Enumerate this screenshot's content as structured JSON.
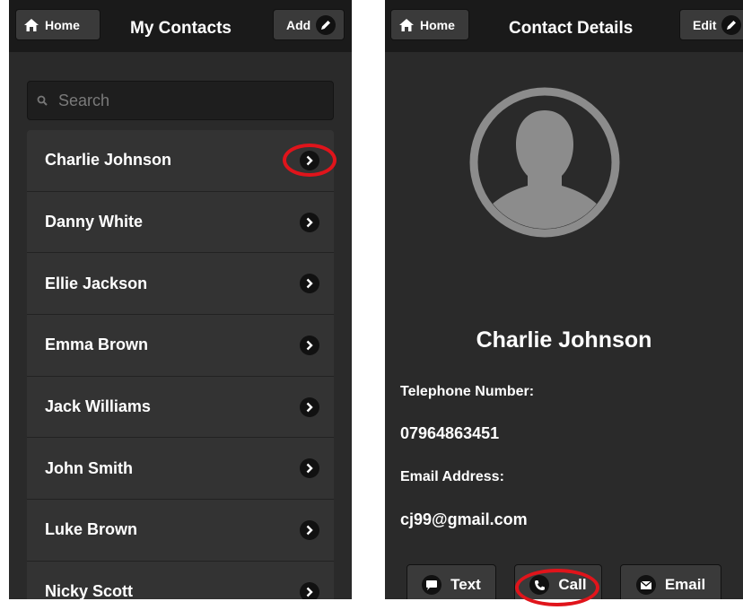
{
  "contacts_screen": {
    "home_label": "Home",
    "title": "My Contacts",
    "add_label": "Add",
    "search_placeholder": "Search",
    "contacts": [
      {
        "name": "Charlie Johnson"
      },
      {
        "name": "Danny White"
      },
      {
        "name": "Ellie Jackson"
      },
      {
        "name": "Emma Brown"
      },
      {
        "name": "Jack Williams"
      },
      {
        "name": "John Smith"
      },
      {
        "name": "Luke Brown"
      },
      {
        "name": "Nicky Scott"
      }
    ],
    "highlighted_contact_index": 0
  },
  "details_screen": {
    "home_label": "Home",
    "title": "Contact Details",
    "edit_label": "Edit",
    "contact_name": "Charlie Johnson",
    "telephone_label": "Telephone Number:",
    "telephone_value": "07964863451",
    "email_label": "Email Address:",
    "email_value": "cj99@gmail.com",
    "actions": {
      "text_label": "Text",
      "call_label": "Call",
      "email_label": "Email"
    },
    "highlighted_action": "call"
  },
  "colors": {
    "background": "#2a2a2a",
    "header": "#1a1a1a",
    "list_row": "#333333",
    "highlight_ring": "#e0141b",
    "avatar": "#8c8c8c"
  }
}
